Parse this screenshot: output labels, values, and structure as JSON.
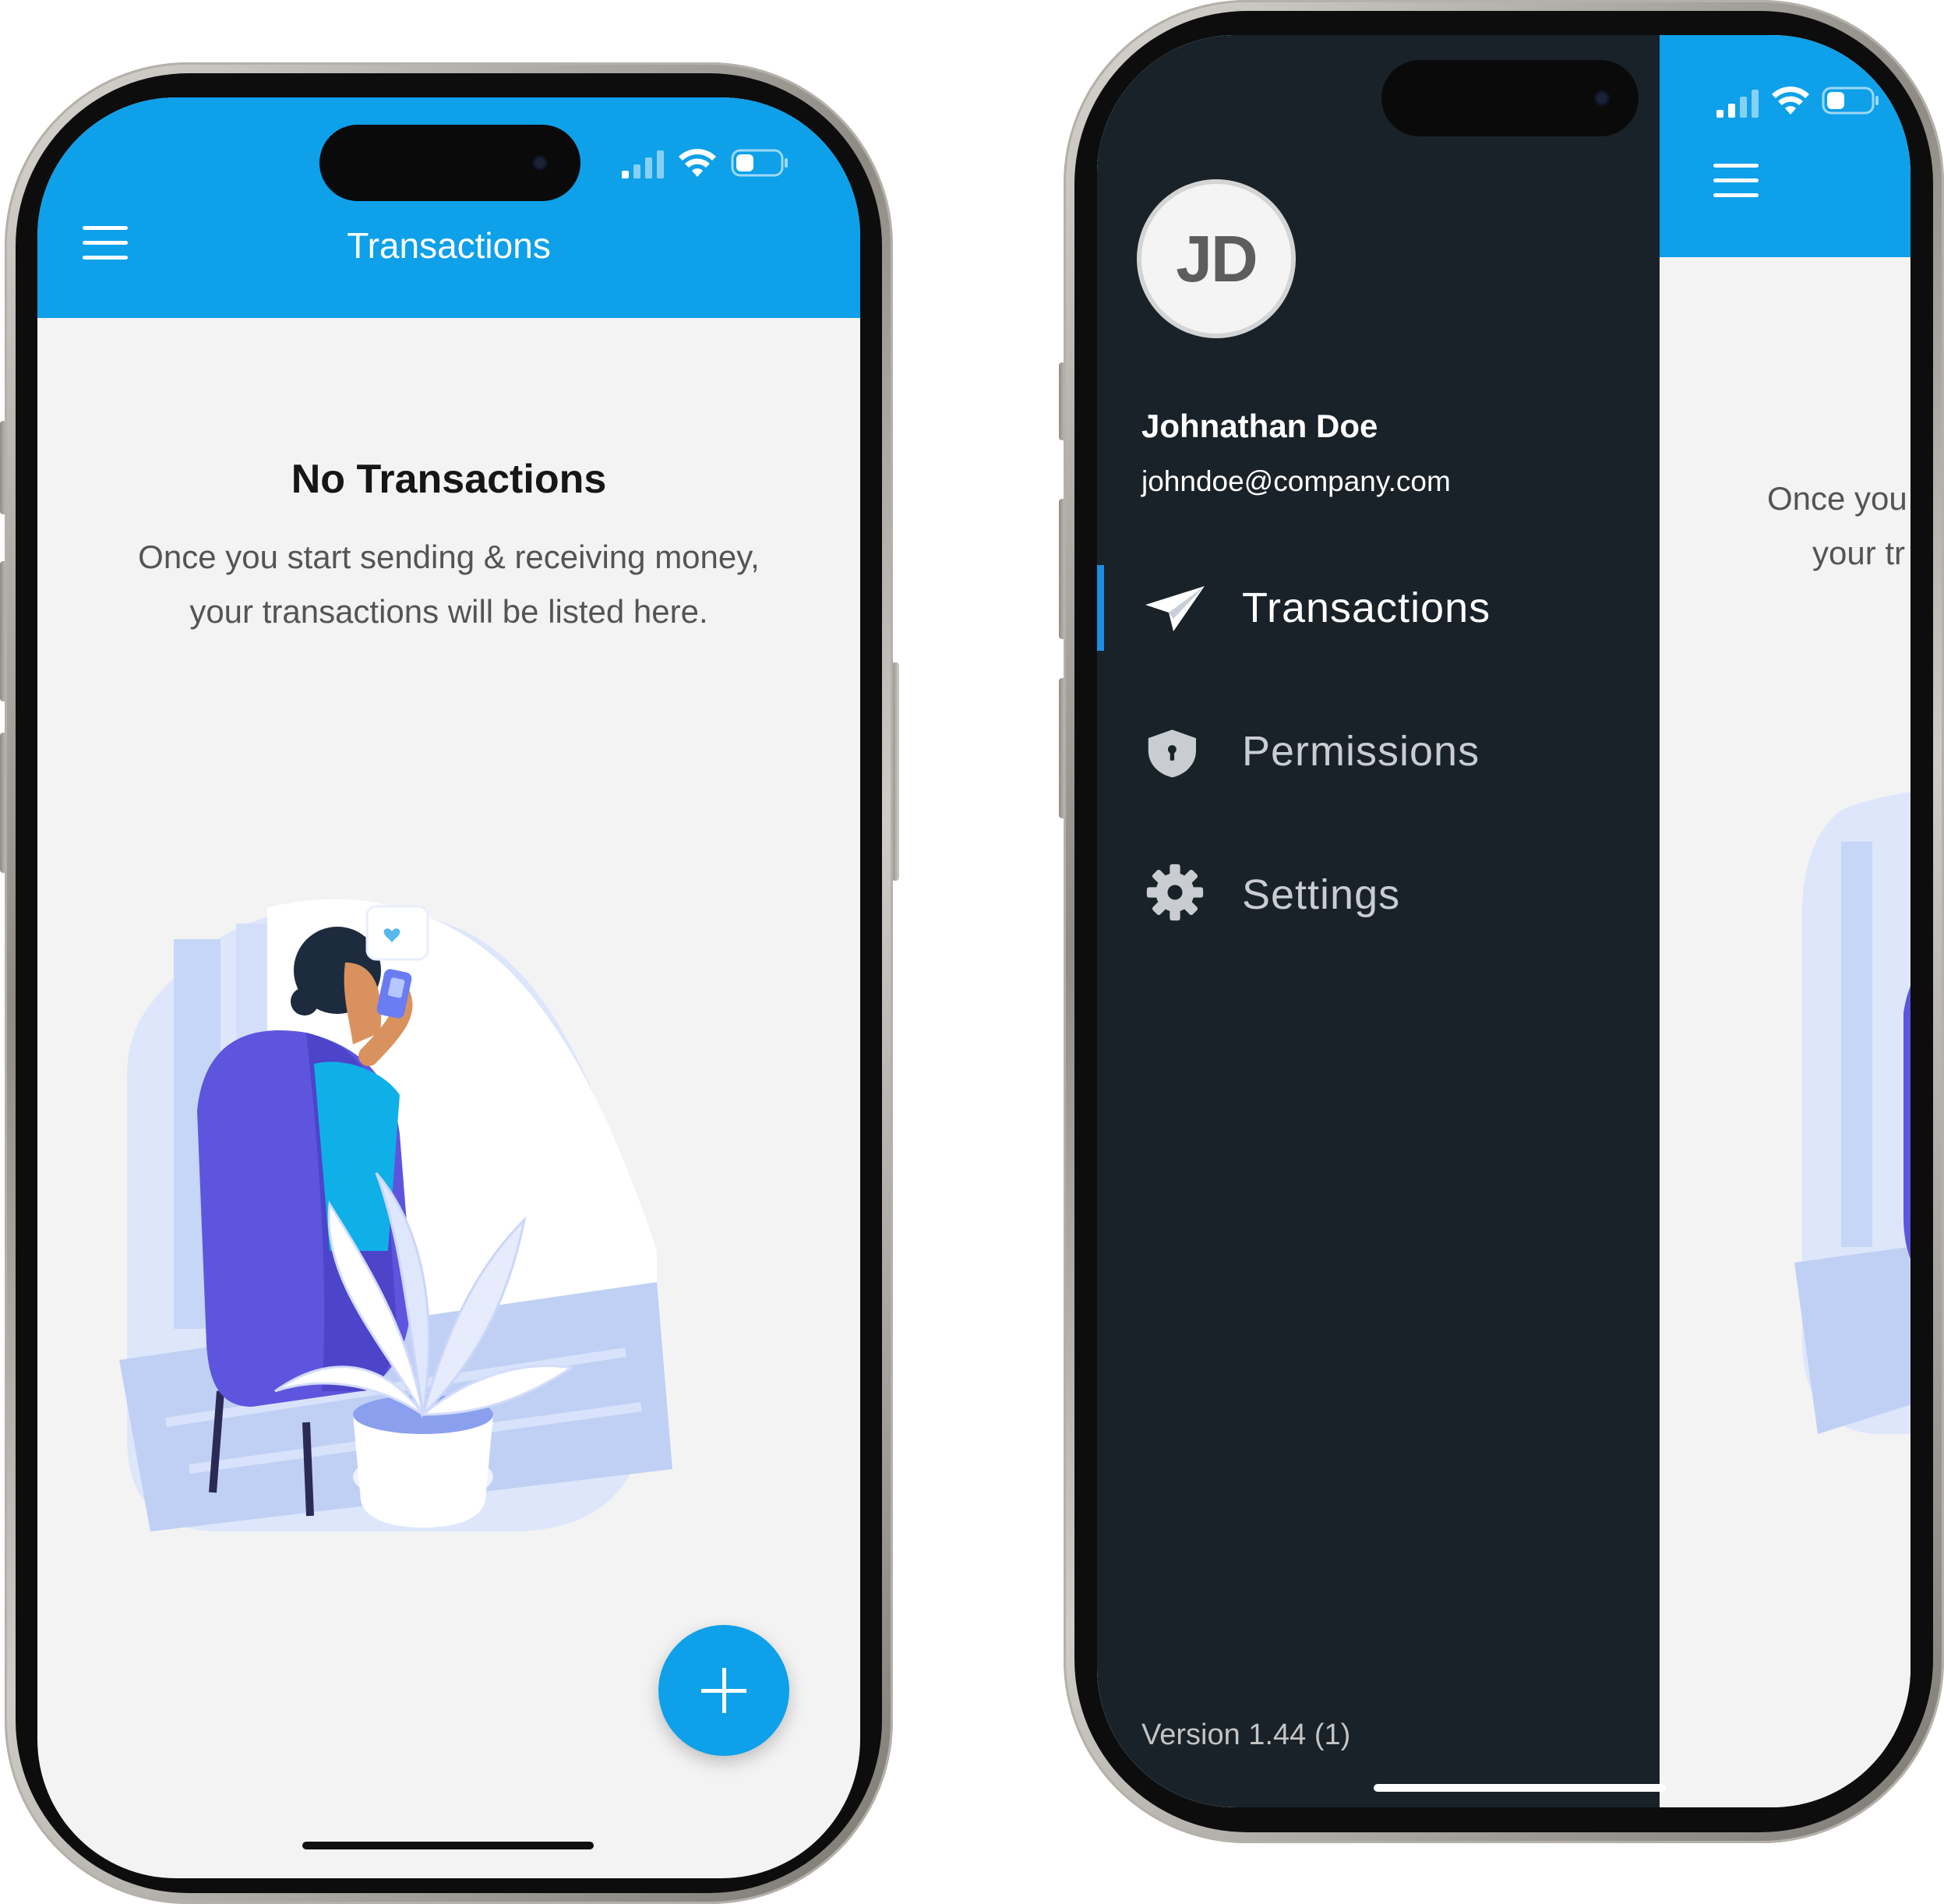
{
  "phone_left": {
    "app_bar": {
      "title": "Transactions",
      "menu_icon": "hamburger-icon"
    },
    "empty_state": {
      "title": "No Transactions",
      "line1": "Once you start sending & receiving money,",
      "line2": "your transactions will be listed here.",
      "illustration": "woman-in-armchair-with-phone-illustration"
    },
    "fab": {
      "icon": "plus-icon"
    }
  },
  "phone_right": {
    "drawer": {
      "avatar_initials": "JD",
      "user_name": "Johnathan Doe",
      "user_email": "johndoe@company.com",
      "items": [
        {
          "label": "Transactions",
          "icon": "paper-plane-icon",
          "active": true
        },
        {
          "label": "Permissions",
          "icon": "shield-lock-icon",
          "active": false
        },
        {
          "label": "Settings",
          "icon": "gear-icon",
          "active": false
        }
      ],
      "version": "Version 1.44 (1)"
    },
    "behind_content": {
      "line1_partial": "Once you",
      "line2_partial": "your tr"
    }
  },
  "colors": {
    "accent_blue": "#0ea0e9",
    "drawer_bg": "#1a2229",
    "page_bg": "#f3f3f3",
    "illustration_purple": "#5d55de",
    "active_indicator": "#1a8fe3"
  }
}
